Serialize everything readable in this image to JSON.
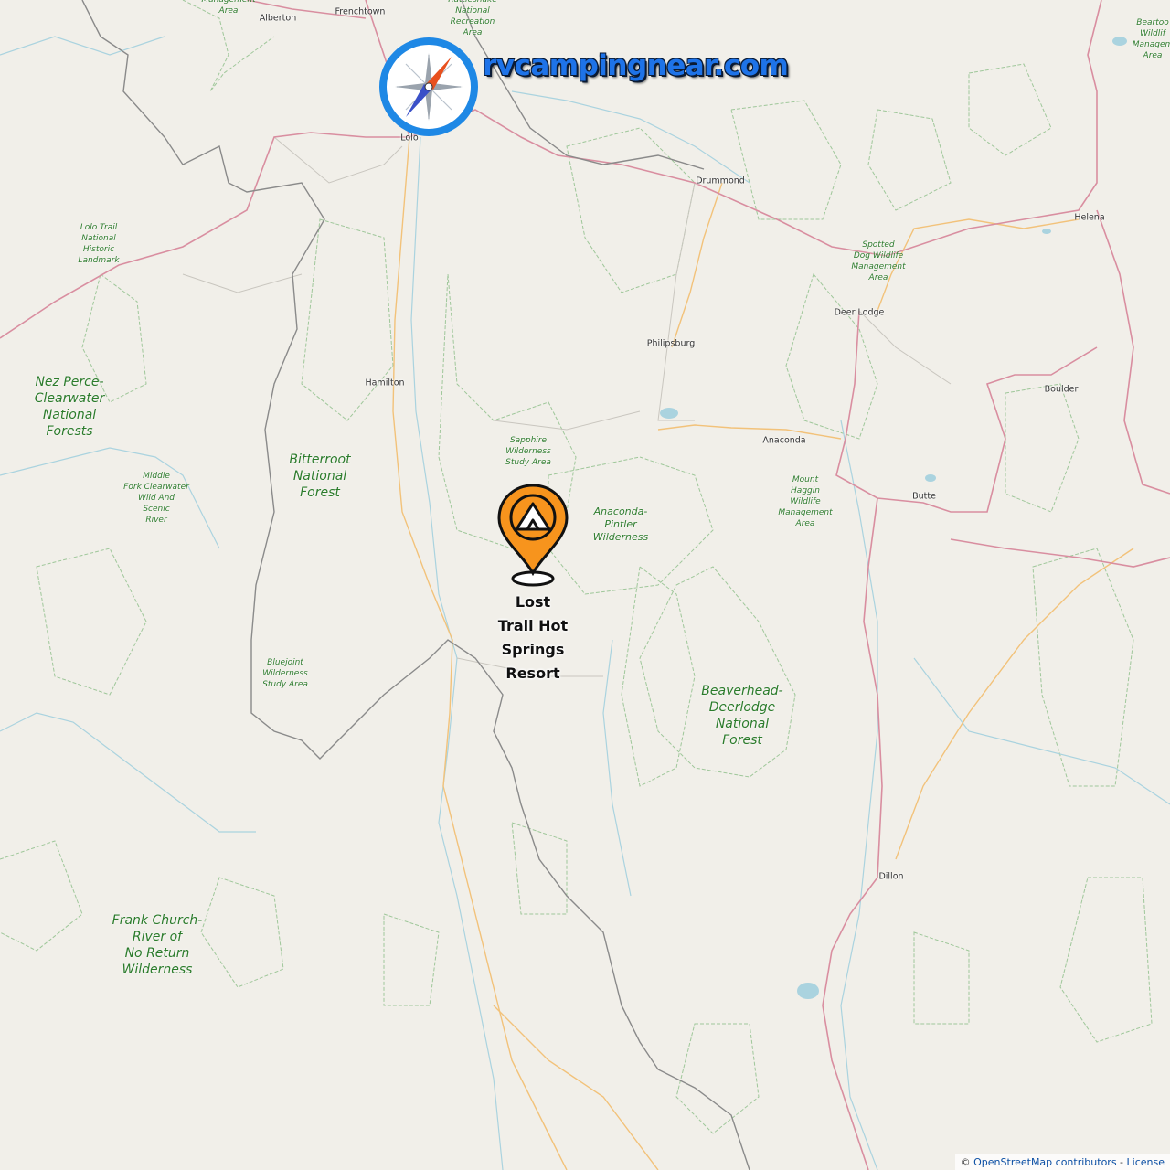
{
  "brand": {
    "name": "rvcampingnear.com",
    "compass_icon": "compass-icon",
    "accent": "#1e88e5",
    "needle_red": "#e8501e",
    "needle_blue": "#3a50c8"
  },
  "poi": {
    "name": "Lost\nTrail Hot\nSprings\nResort",
    "marker_icon": "tent-pin-icon",
    "color": "#f7941d"
  },
  "towns": [
    {
      "id": "alberton",
      "name": "Alberton"
    },
    {
      "id": "frenchtown",
      "name": "Frenchtown"
    },
    {
      "id": "lolo",
      "name": "Lolo"
    },
    {
      "id": "drummond",
      "name": "Drummond"
    },
    {
      "id": "helena",
      "name": "Helena"
    },
    {
      "id": "deer-lodge",
      "name": "Deer Lodge"
    },
    {
      "id": "philipsburg",
      "name": "Philipsburg"
    },
    {
      "id": "hamilton",
      "name": "Hamilton"
    },
    {
      "id": "boulder",
      "name": "Boulder"
    },
    {
      "id": "anaconda",
      "name": "Anaconda"
    },
    {
      "id": "butte",
      "name": "Butte"
    },
    {
      "id": "dillon",
      "name": "Dillon"
    }
  ],
  "areas": [
    {
      "id": "management-area-top",
      "name": "Management\nArea"
    },
    {
      "id": "rattlesnake",
      "name": "Rattlesnake\nNational\nRecreation\nArea"
    },
    {
      "id": "beartooth",
      "name": "Beartoo\nWildlif\nManagem\nArea"
    },
    {
      "id": "lolo-trail",
      "name": "Lolo Trail\nNational\nHistoric\nLandmark"
    },
    {
      "id": "spotted-dog",
      "name": "Spotted\nDog Wildlife\nManagement\nArea"
    },
    {
      "id": "sapphire",
      "name": "Sapphire\nWilderness\nStudy Area"
    },
    {
      "id": "middle-fork",
      "name": "Middle\nFork Clearwater\nWild And\nScenic\nRiver"
    },
    {
      "id": "mount-haggin",
      "name": "Mount\nHaggin\nWildlife\nManagement\nArea"
    },
    {
      "id": "bluejoint",
      "name": "Bluejoint\nWilderness\nStudy Area"
    }
  ],
  "forests": [
    {
      "id": "nez-perce",
      "name": "Nez Perce-\nClearwater\nNational\nForests"
    },
    {
      "id": "bitterroot",
      "name": "Bitterroot\nNational\nForest"
    },
    {
      "id": "anaconda-pintler",
      "name": "Anaconda-\nPintler\nWilderness"
    },
    {
      "id": "beaverhead",
      "name": "Beaverhead-\nDeerlodge\nNational\nForest"
    },
    {
      "id": "frank-church",
      "name": "Frank Church-\nRiver of\nNo Return\nWilderness"
    }
  ],
  "attribution": {
    "copyright": "©",
    "osm_link": "OpenStreetMap contributors",
    "separator": " - ",
    "license_link": "License"
  }
}
